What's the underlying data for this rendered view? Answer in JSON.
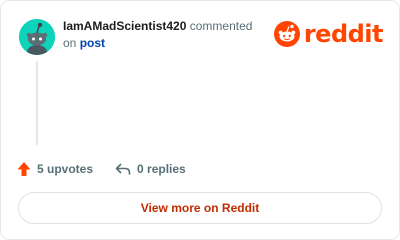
{
  "comment": {
    "author": "IamAMadScientist420",
    "action_text": "commented",
    "on_text": "on",
    "post_link_text": "post",
    "body": ""
  },
  "brand": {
    "name": "reddit",
    "color": "#ff4500"
  },
  "stats": {
    "upvotes_label": "5 upvotes",
    "replies_label": "0 replies"
  },
  "footer": {
    "view_more_label": "View more on Reddit"
  },
  "colors": {
    "avatar_bg": "#0dd3bb",
    "upvote_arrow": "#ff4500",
    "link": "#0045ac",
    "button_text": "#c12b00"
  },
  "icons": [
    "snoo-avatar-icon",
    "reddit-logo-icon",
    "upvote-arrow-icon",
    "reply-arrow-icon"
  ]
}
